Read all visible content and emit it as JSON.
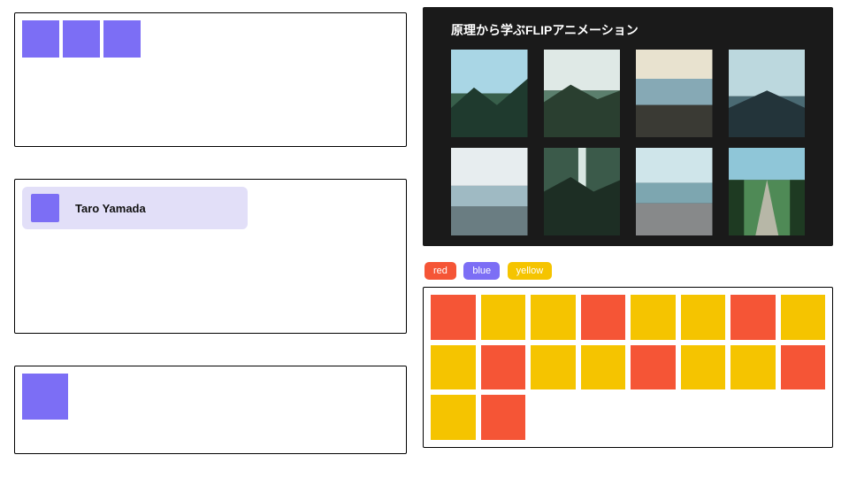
{
  "colors": {
    "purple": "#7c6ef5",
    "purple_light": "#e2dff8",
    "red": "#f55536",
    "yellow": "#f5c400",
    "dark": "#1a1a1a"
  },
  "left": {
    "panel1": {
      "square_count": 3
    },
    "panel2": {
      "user": {
        "name": "Taro Yamada"
      }
    },
    "panel3": {
      "square_count": 1
    }
  },
  "gallery": {
    "title": "原理から学ぶFLIPアニメーション",
    "thumbs": 8
  },
  "filters": [
    {
      "key": "red",
      "label": "red"
    },
    {
      "key": "blue",
      "label": "blue"
    },
    {
      "key": "yellow",
      "label": "yellow"
    }
  ],
  "color_grid": {
    "cells": [
      "red",
      "yellow",
      "yellow",
      "red",
      "yellow",
      "yellow",
      "red",
      "yellow",
      "yellow",
      "red",
      "yellow",
      "yellow",
      "red",
      "yellow",
      "yellow",
      "red",
      "yellow",
      "red"
    ]
  }
}
